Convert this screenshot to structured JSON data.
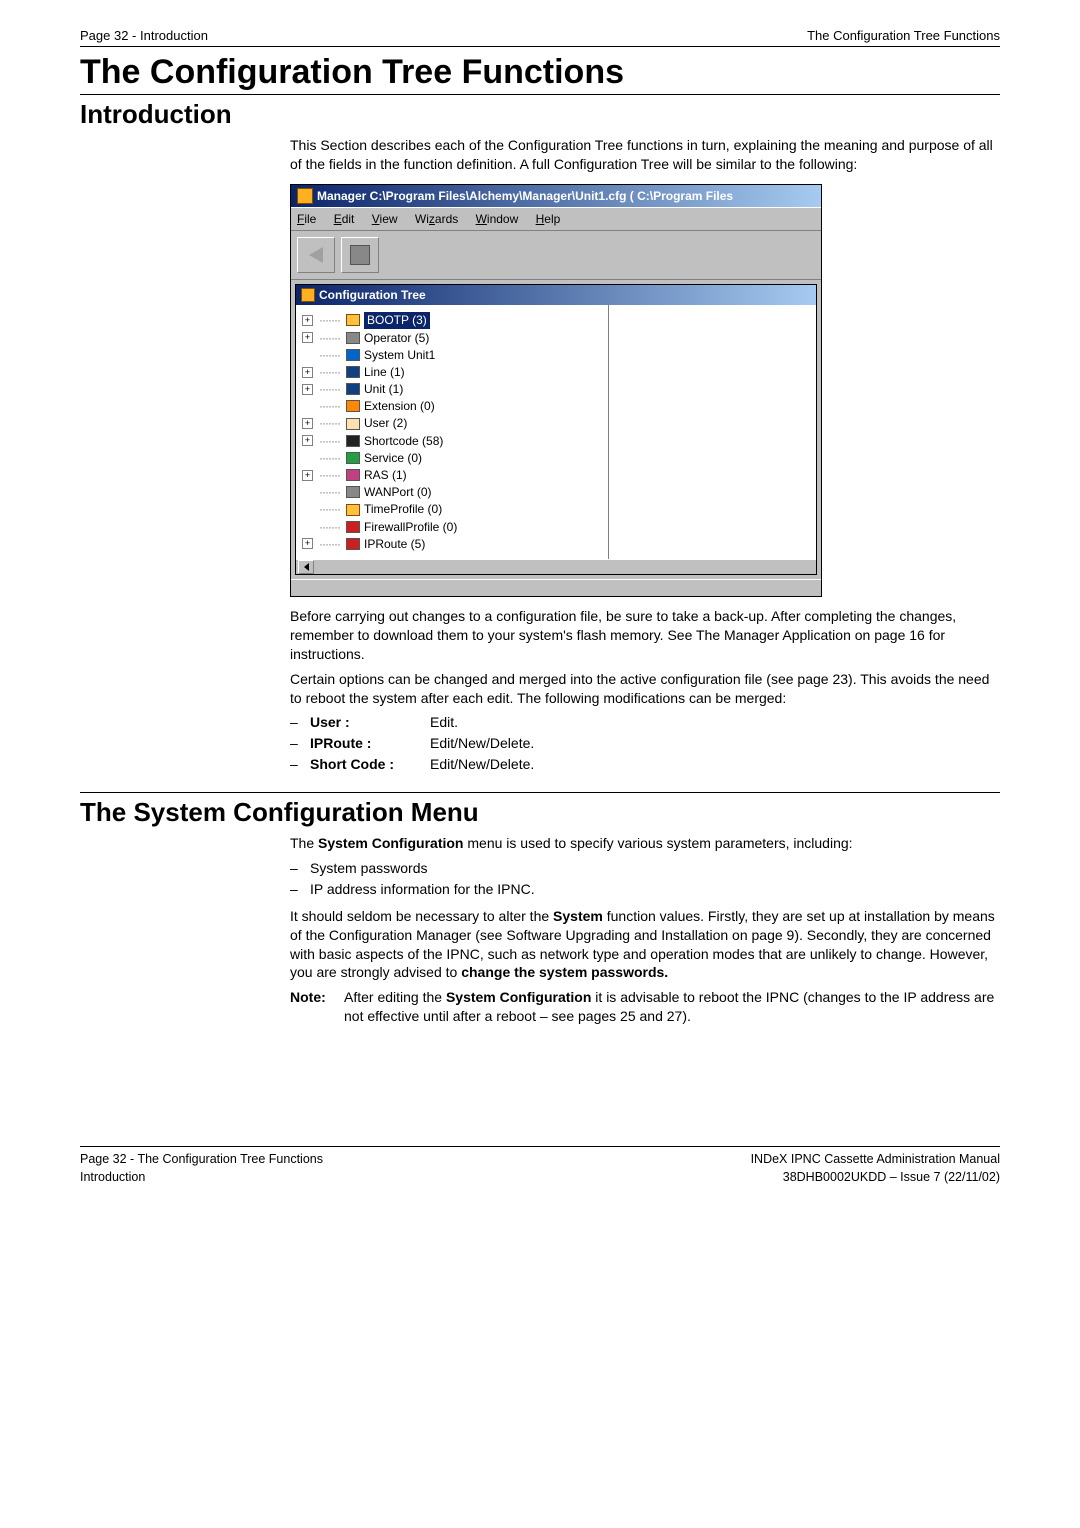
{
  "header": {
    "left": "Page 32 - Introduction",
    "right": "The Configuration Tree Functions"
  },
  "title": "The Configuration Tree Functions",
  "intro": {
    "heading": "Introduction",
    "p1": "This Section describes each of the Configuration Tree functions in turn, explaining the meaning and purpose of all of the fields in the function definition. A full Configuration Tree will be similar to the following:",
    "p2": "Before carrying out changes to a configuration file, be sure to take a back-up. After completing the changes, remember to download them to your system's flash memory. See The Manager Application on page 16 for instructions.",
    "p3": "Certain options can be changed and merged into the active configuration file (see page 23). This avoids the need to reboot the system after each edit. The following modifications can be merged:",
    "merge_list": [
      {
        "label": "User :",
        "text": "Edit."
      },
      {
        "label": "IPRoute :",
        "text": "Edit/New/Delete."
      },
      {
        "label": "Short Code :",
        "text": "Edit/New/Delete."
      }
    ]
  },
  "sysmenu": {
    "heading": "The System Configuration Menu",
    "p1a": "The ",
    "p1b": "System Configuration",
    "p1c": " menu is used to specify various system parameters, including:",
    "bullets": [
      "System passwords",
      "IP address information for the IPNC."
    ],
    "p2a": "It should seldom be necessary to alter the ",
    "p2b": "System",
    "p2c": " function values. Firstly, they are set up at installation by means of the Configuration Manager (see Software Upgrading and Installation on page 9). Secondly, they are concerned with basic aspects of the IPNC, such as network type and operation modes that are unlikely to change. However, you are strongly advised to ",
    "p2d": "change the system passwords.",
    "note_label": "Note:",
    "note_a": "After editing the ",
    "note_b": "System Configuration",
    "note_c": " it is advisable to reboot the IPNC (changes to the IP address are not effective until after a reboot – see pages 25 and 27)."
  },
  "shot": {
    "win_title": "Manager  C:\\Program Files\\Alchemy\\Manager\\Unit1.cfg  ( C:\\Program Files",
    "menu": {
      "file": "File",
      "edit": "Edit",
      "view": "View",
      "wizards": "Wizards",
      "window": "Window",
      "help": "Help"
    },
    "panel_title": "Configuration Tree",
    "nodes": [
      {
        "pm": "+",
        "cls": "ic-yellow",
        "label": "BOOTP (3)",
        "selected": true
      },
      {
        "pm": "+",
        "cls": "ic-gray",
        "label": "Operator (5)"
      },
      {
        "pm": "",
        "cls": "ic-blue",
        "label": "System Unit1"
      },
      {
        "pm": "+",
        "cls": "ic-navy",
        "label": "Line (1)"
      },
      {
        "pm": "+",
        "cls": "ic-navy",
        "label": "Unit (1)"
      },
      {
        "pm": "",
        "cls": "ic-orange",
        "label": "Extension (0)"
      },
      {
        "pm": "+",
        "cls": "ic-person",
        "label": "User (2)"
      },
      {
        "pm": "+",
        "cls": "ic-black",
        "label": "Shortcode (58)"
      },
      {
        "pm": "",
        "cls": "ic-green",
        "label": "Service (0)"
      },
      {
        "pm": "+",
        "cls": "ic-magenta",
        "label": "RAS (1)"
      },
      {
        "pm": "",
        "cls": "ic-gray",
        "label": "WANPort (0)"
      },
      {
        "pm": "",
        "cls": "ic-yellow",
        "label": "TimeProfile (0)"
      },
      {
        "pm": "",
        "cls": "ic-red",
        "label": "FirewallProfile (0)"
      },
      {
        "pm": "+",
        "cls": "ic-red",
        "label": "IPRoute (5)"
      }
    ]
  },
  "footer": {
    "left1": "Page 32 - The Configuration Tree Functions",
    "left2": "Introduction",
    "right1": "INDeX IPNC Cassette Administration Manual",
    "right2": "38DHB0002UKDD – Issue 7 (22/11/02)"
  }
}
